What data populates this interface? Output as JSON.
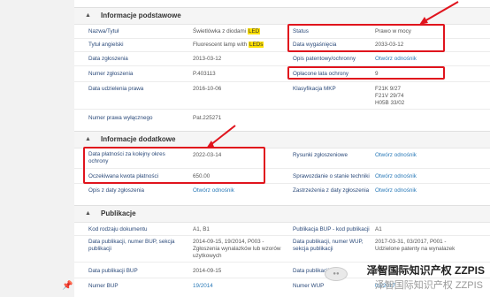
{
  "sections": {
    "basic": {
      "title": "Informacje podstawowe"
    },
    "additional": {
      "title": "Informacje dodatkowe"
    },
    "publications": {
      "title": "Publikacje"
    }
  },
  "basic": {
    "name_label": "Nazwa/Tytuł",
    "name_value_pre": "Świetlówka z diodami ",
    "name_value_hl": "LED",
    "status_label": "Status",
    "status_value": "Prawo w mocy",
    "title_en_label": "Tytuł angielski",
    "title_en_pre": "Fluorescent lamp with ",
    "title_en_hl": "LEDs",
    "expiry_label": "Data wygaśnięcia",
    "expiry_value": "2033-03-12",
    "filing_date_label": "Data zgłoszenia",
    "filing_date_value": "2013-03-12",
    "patent_desc_label": "Opis patentowy/ochronny",
    "patent_desc_link": "Otwórz odnośnik",
    "app_number_label": "Numer zgłoszenia",
    "app_number_value": "P.403113",
    "fees_label": "Opłacone lata ochrony",
    "fees_value": "9",
    "grant_date_label": "Data udzielenia prawa",
    "grant_date_value": "2016-10-06",
    "ipc_label": "Klasyfikacja MKP",
    "ipc_values": [
      "F21K 9/27",
      "F21V 29/74",
      "H05B 33/02"
    ],
    "exclusive_label": "Numer prawa wyłącznego",
    "exclusive_value": "Pat.225271"
  },
  "additional": {
    "payment_label": "Data płatności za kolejny okres ochrony",
    "payment_value": "2022-03-14",
    "drawings_label": "Rysunki zgłoszeniowe",
    "drawings_link": "Otwórz odnośnik",
    "fee_amount_label": "Oczekiwana kwota płatności",
    "fee_amount_value": "650.00",
    "tech_report_label": "Sprawozdanie o stanie techniki",
    "tech_report_link": "Otwórz odnośnik",
    "app_desc_label": "Opis z daty zgłoszenia",
    "app_desc_link": "Otwórz odnośnik",
    "claims_label": "Zastrzeżenia z daty zgłoszenia",
    "claims_link": "Otwórz odnośnik"
  },
  "publications": {
    "doc_code_label": "Kod rodzaju dokumentu",
    "doc_code_value": "A1, B1",
    "bup_code_label": "Publikacja BUP - kod publikacji",
    "bup_code_value": "A1",
    "pub_date_label": "Data publikacji, numer BUP, sekcja publikacji",
    "pub_date_value": "2014-09-15, 19/2014, P003 - Zgłoszenia wynalazków lub wzorów użytkowych",
    "wup_label": "Data publikacji, numer WUP, sekcja publikacji",
    "wup_value": "2017-03-31, 03/2017, P001 - Udzielone patenty na wynalazek",
    "bup_pub_label": "Data publikacji BUP",
    "bup_pub_value": "2014-09-15",
    "wup_pub_label": "Data publikacji WUP",
    "wup_pub_value": "2017-03-31",
    "bup_num_label": "Numer BUP",
    "bup_num_value": "19/2014",
    "wup_num_label": "Numer WUP",
    "wup_num_value": "03/2017"
  },
  "watermark": {
    "line1": "泽智国际知识产权 ZZPIS",
    "line2": "泽智国际知识产权 ZZPIS"
  },
  "colors": {
    "accent": "#2a7ab8",
    "label": "#2b4a7a",
    "highlight_box": "#e0141d",
    "highlight_text": "#ffe000"
  }
}
